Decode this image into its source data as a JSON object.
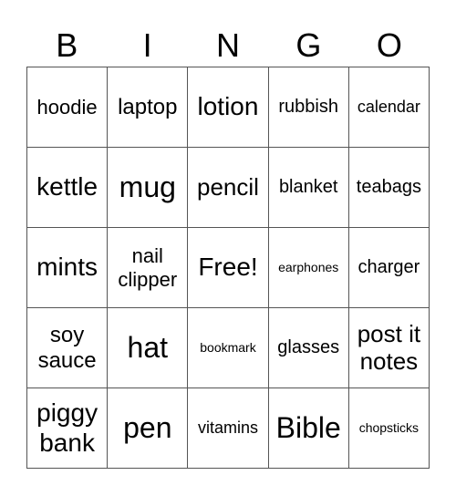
{
  "header": [
    "B",
    "I",
    "N",
    "G",
    "O"
  ],
  "cells": [
    [
      "hoodie",
      "laptop",
      "lotion",
      "rubbish",
      "calendar"
    ],
    [
      "kettle",
      "mug",
      "pencil",
      "blanket",
      "teabags"
    ],
    [
      "mints",
      "nail clipper",
      "Free!",
      "earphones",
      "charger"
    ],
    [
      "soy sauce",
      "hat",
      "bookmark",
      "glasses",
      "post it notes"
    ],
    [
      "piggy bank",
      "pen",
      "vitamins",
      "Bible",
      "chopsticks"
    ]
  ]
}
